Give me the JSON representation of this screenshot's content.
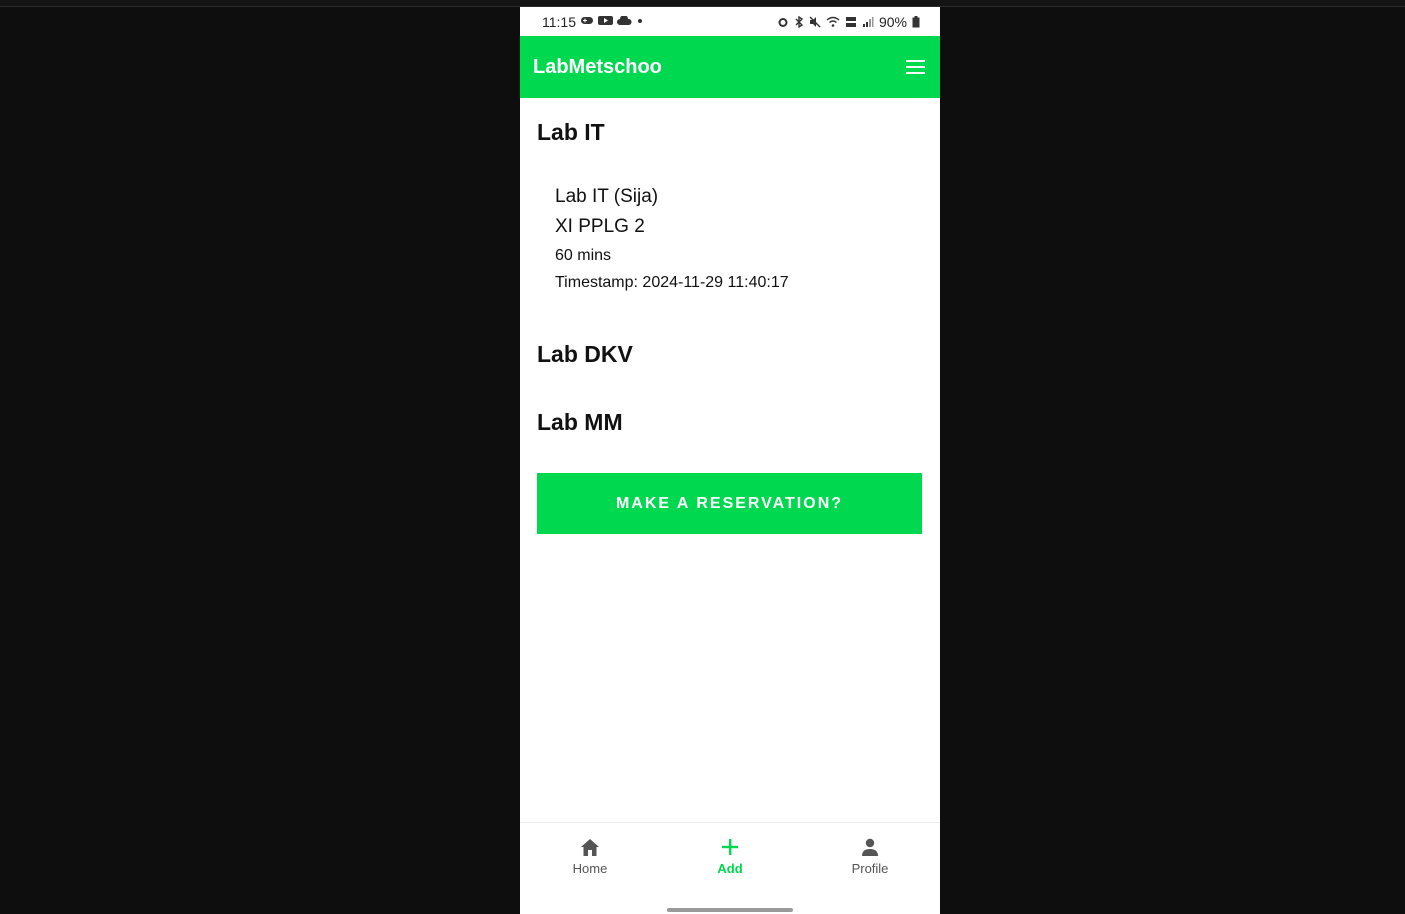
{
  "status_bar": {
    "time": "11:15",
    "battery": "90%"
  },
  "app_bar": {
    "title": "LabMetschoo"
  },
  "labs": [
    {
      "name": "Lab IT",
      "details": {
        "room": "Lab IT (Sija)",
        "class": "XI PPLG 2",
        "duration": "60 mins",
        "timestamp": "Timestamp: 2024-11-29 11:40:17"
      }
    },
    {
      "name": "Lab DKV"
    },
    {
      "name": "Lab MM"
    }
  ],
  "reserve_button": "MAKE A RESERVATION?",
  "bottom_nav": [
    {
      "label": "Home",
      "icon": "home-icon"
    },
    {
      "label": "Add",
      "icon": "plus-icon",
      "active": true
    },
    {
      "label": "Profile",
      "icon": "person-icon"
    }
  ],
  "colors": {
    "accent": "#00d94f",
    "background": "#ffffff",
    "outer": "#0e0e0e"
  }
}
